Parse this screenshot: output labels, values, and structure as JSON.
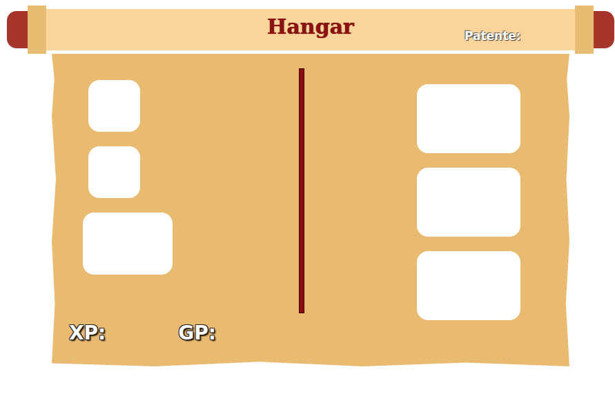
{
  "title": "Hangar",
  "rank": {
    "label": "Patente:"
  },
  "left_slots": [
    {
      "kind": "small"
    },
    {
      "kind": "small"
    },
    {
      "kind": "wide"
    }
  ],
  "right_slots": [
    {
      "kind": "large"
    },
    {
      "kind": "large"
    },
    {
      "kind": "large"
    }
  ],
  "stats": [
    {
      "label": "XP:"
    },
    {
      "label": "GP:"
    }
  ]
}
